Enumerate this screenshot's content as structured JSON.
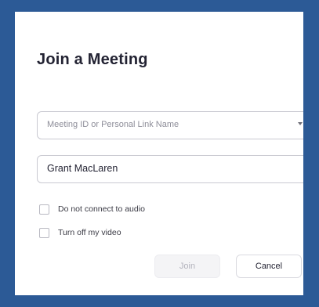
{
  "dialog": {
    "title": "Join a Meeting",
    "meeting_field": {
      "placeholder": "Meeting ID or Personal Link Name",
      "value": "",
      "dropdown_icon": "chevron-down-icon"
    },
    "name_field": {
      "value": "Grant MacLaren"
    },
    "options": [
      {
        "label": "Do not connect to audio",
        "checked": false
      },
      {
        "label": "Turn off my video",
        "checked": false
      }
    ],
    "buttons": {
      "join_label": "Join",
      "join_enabled": false,
      "cancel_label": "Cancel"
    }
  },
  "colors": {
    "border_frame": "#2c5a96",
    "panel_background": "#ffffff",
    "title_text": "#232333",
    "disabled_button_text": "#b3b3bd"
  }
}
